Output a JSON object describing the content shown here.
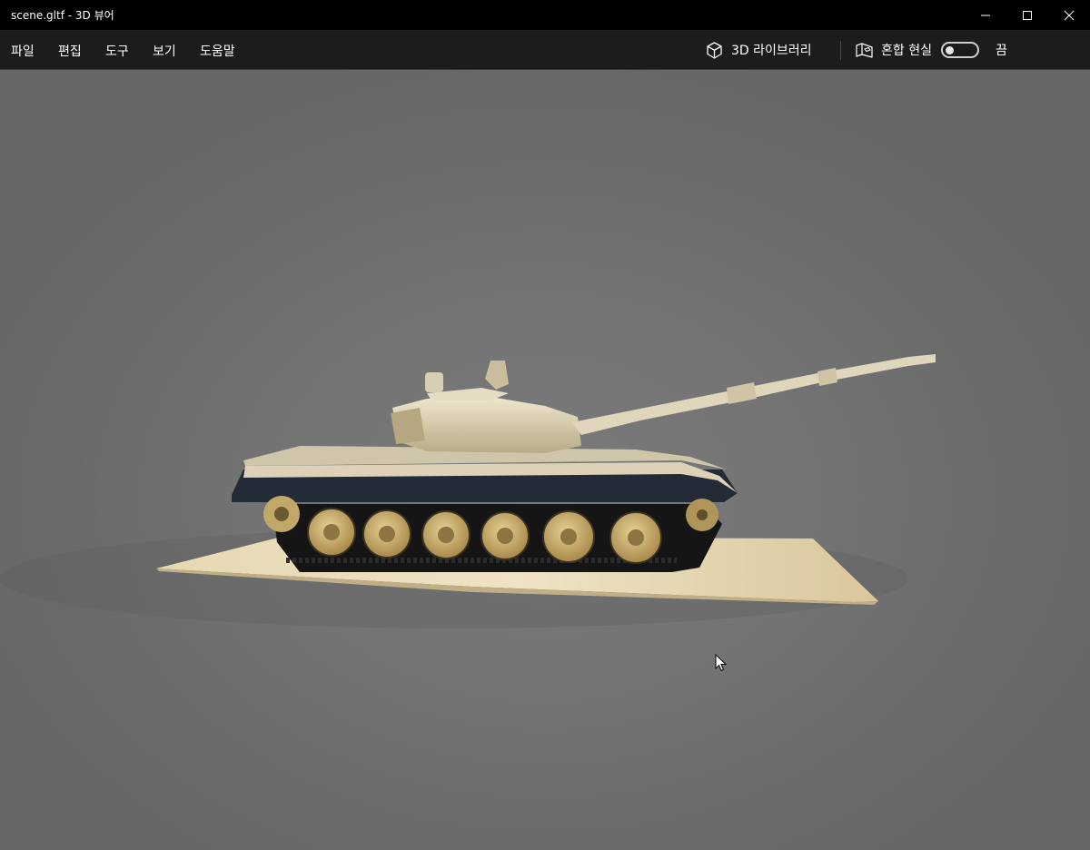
{
  "window": {
    "title": "scene.gltf - 3D 뷰어"
  },
  "titlebar_buttons": {
    "minimize_icon": "minimize-icon",
    "maximize_icon": "maximize-icon",
    "close_icon": "close-icon"
  },
  "menu": {
    "items": [
      {
        "label": "파일"
      },
      {
        "label": "편집"
      },
      {
        "label": "도구"
      },
      {
        "label": "보기"
      },
      {
        "label": "도움말"
      }
    ]
  },
  "toolbar": {
    "library_label": "3D 라이브러리",
    "library_icon": "cube-icon",
    "mixed_reality_label": "혼합 현실",
    "mixed_reality_icon": "mixed-reality-icon",
    "mixed_reality_state": "끔",
    "mixed_reality_on": false
  },
  "colors": {
    "titlebar_bg": "#000000",
    "menubar_bg": "#1c1c1c",
    "viewport_bg": "#6c6c6c"
  }
}
